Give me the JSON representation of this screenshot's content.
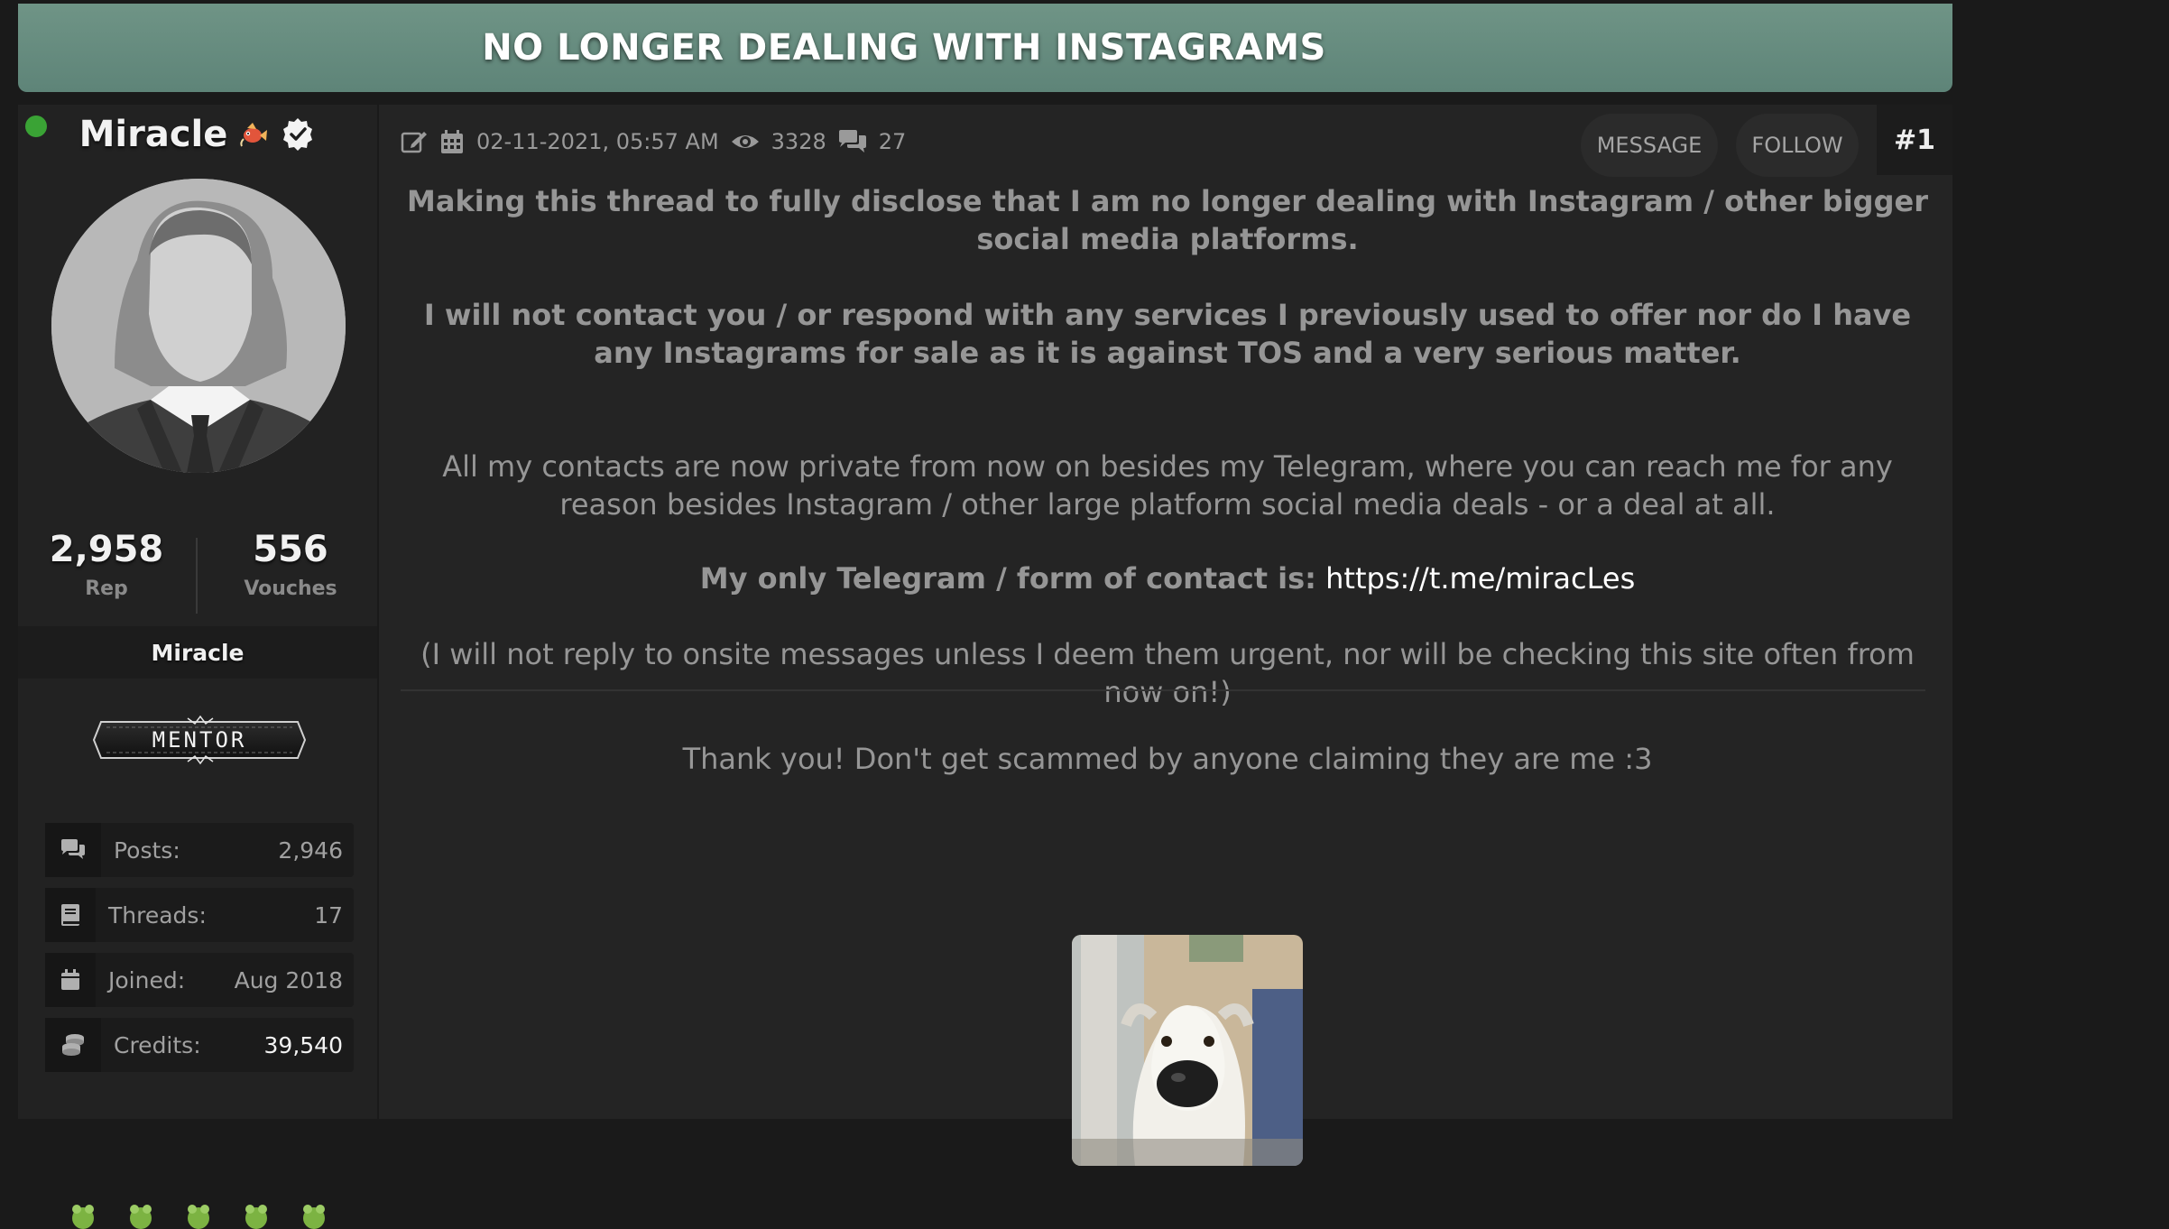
{
  "thread": {
    "title": "NO LONGER DEALING WITH INSTAGRAMS"
  },
  "user": {
    "name": "Miracle",
    "status": "online",
    "rep": "2,958",
    "rep_label": "Rep",
    "vouches": "556",
    "vouches_label": "Vouches",
    "usertitle": "Miracle",
    "rank_badge": "MENTOR",
    "info": [
      {
        "icon": "comments-icon",
        "label": "Posts:",
        "value": "2,946"
      },
      {
        "icon": "book-icon",
        "label": "Threads:",
        "value": "17"
      },
      {
        "icon": "calendar-icon",
        "label": "Joined:",
        "value": "Aug 2018"
      },
      {
        "icon": "coins-icon",
        "label": "Credits:",
        "value": "39,540"
      }
    ]
  },
  "post": {
    "date": "02-11-2021, 05:57 AM",
    "views": "3328",
    "replies": "27",
    "message_label": "MESSAGE",
    "follow_label": "FOLLOW",
    "number": "#1",
    "para1": "Making this thread to fully disclose that I am no longer dealing with Instagram / other bigger social media platforms.",
    "para2": "I will not contact you / or respond with any services I previously used to offer nor do I have any Instagrams for sale as it is against TOS and a very serious matter.",
    "para3": "All my contacts are now private from now on besides my Telegram, where you can reach me for any reason besides Instagram / other large platform social media deals - or a deal at all.",
    "contact_prefix": "My only Telegram / form of contact is:",
    "contact_link": "https://t.me/miracLes",
    "para5": "(I will not reply to onsite messages unless I deem them urgent, nor will be checking this site often from now on!)",
    "para6": "Thank you! Don't get scammed by anyone claiming they are me :3"
  },
  "colors": {
    "banner": "#668c7f",
    "background": "#1a1a1a",
    "panel": "#242424",
    "online": "#3aa335"
  }
}
